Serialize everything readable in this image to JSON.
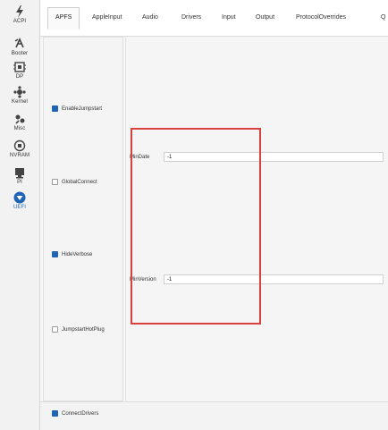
{
  "sidebar": {
    "items": [
      {
        "label": "ACPI",
        "icon": "lightning-icon"
      },
      {
        "label": "Booter",
        "icon": "boot-icon"
      },
      {
        "label": "DP",
        "icon": "device-properties-icon"
      },
      {
        "label": "Kernel",
        "icon": "kernel-icon"
      },
      {
        "label": "Misc",
        "icon": "misc-icon"
      },
      {
        "label": "NVRAM",
        "icon": "nvram-icon"
      },
      {
        "label": "PI",
        "icon": "platform-info-icon"
      },
      {
        "label": "UEFI",
        "icon": "uefi-icon",
        "active": true
      }
    ]
  },
  "tabs": [
    {
      "label": "APFS",
      "active": true
    },
    {
      "label": "AppleInput"
    },
    {
      "label": "Audio"
    },
    {
      "label": "Drivers"
    },
    {
      "label": "Input"
    },
    {
      "label": "Output"
    },
    {
      "label": "ProtocolOverrides"
    },
    {
      "label": "Q"
    }
  ],
  "checkboxes": {
    "enable_jumpstart": {
      "label": "EnableJumpstart",
      "checked": true
    },
    "global_connect": {
      "label": "GlobalConnect",
      "checked": false
    },
    "hide_verbose": {
      "label": "HideVerbose",
      "checked": true
    },
    "jumpstart_hotplug": {
      "label": "JumpstartHotPlug",
      "checked": false
    },
    "connect_drivers": {
      "label": "ConnectDrivers",
      "checked": true
    }
  },
  "fields": {
    "min_date": {
      "label": "MinDate",
      "value": "-1"
    },
    "min_version": {
      "label": "MinVersion",
      "value": "-1"
    }
  },
  "colors": {
    "accent": "#1e63b5",
    "highlight": "#d9423c"
  }
}
